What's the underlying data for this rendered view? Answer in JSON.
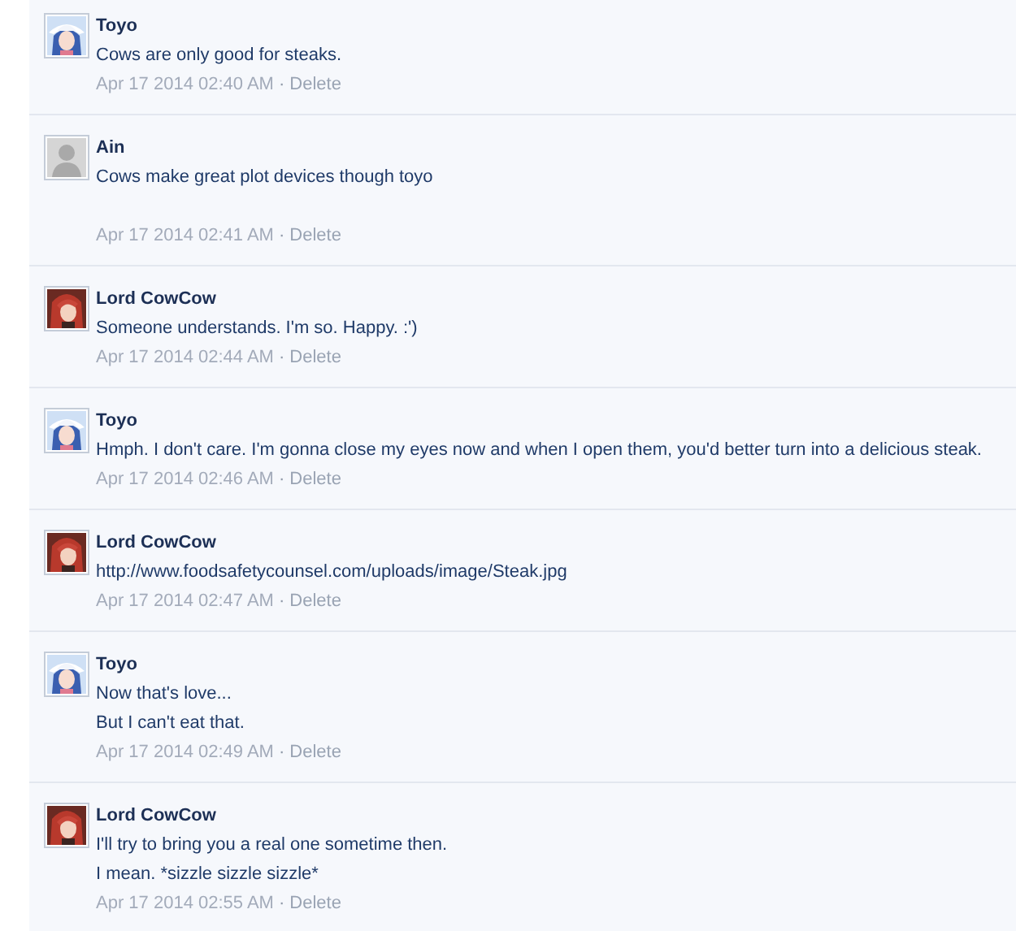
{
  "comments": [
    {
      "author": "Toyo",
      "avatar": {
        "kind": "hat"
      },
      "lines": [
        "Cows are only good for steaks."
      ],
      "blank_line_after": false,
      "time": "Apr 17 2014 02:40 AM",
      "separator": "·",
      "action": "Delete"
    },
    {
      "author": "Ain",
      "avatar": {
        "kind": "default"
      },
      "lines": [
        "Cows make great plot devices though toyo"
      ],
      "blank_line_after": true,
      "time": "Apr 17 2014 02:41 AM",
      "separator": "·",
      "action": "Delete"
    },
    {
      "author": "Lord CowCow",
      "avatar": {
        "kind": "redhead"
      },
      "lines": [
        "Someone understands. I'm so. Happy. :')"
      ],
      "blank_line_after": false,
      "time": "Apr 17 2014 02:44 AM",
      "separator": "·",
      "action": "Delete"
    },
    {
      "author": "Toyo",
      "avatar": {
        "kind": "hat"
      },
      "lines": [
        "Hmph. I don't care. I'm gonna close my eyes now and when I open them, you'd better turn into a delicious steak."
      ],
      "blank_line_after": false,
      "time": "Apr 17 2014 02:46 AM",
      "separator": "·",
      "action": "Delete"
    },
    {
      "author": "Lord CowCow",
      "avatar": {
        "kind": "redhead"
      },
      "lines": [
        "http://www.foodsafetycounsel.com/uploads/image/Steak.jpg"
      ],
      "blank_line_after": false,
      "time": "Apr 17 2014 02:47 AM",
      "separator": "·",
      "action": "Delete"
    },
    {
      "author": "Toyo",
      "avatar": {
        "kind": "hat"
      },
      "lines": [
        "Now that's love...",
        "But I can't eat that."
      ],
      "blank_line_after": false,
      "time": "Apr 17 2014 02:49 AM",
      "separator": "·",
      "action": "Delete"
    },
    {
      "author": "Lord CowCow",
      "avatar": {
        "kind": "redhead"
      },
      "lines": [
        "I'll try to bring you a real one sometime then.",
        "I mean. *sizzle sizzle sizzle*"
      ],
      "blank_line_after": false,
      "time": "Apr 17 2014 02:55 AM",
      "separator": "·",
      "action": "Delete"
    }
  ]
}
